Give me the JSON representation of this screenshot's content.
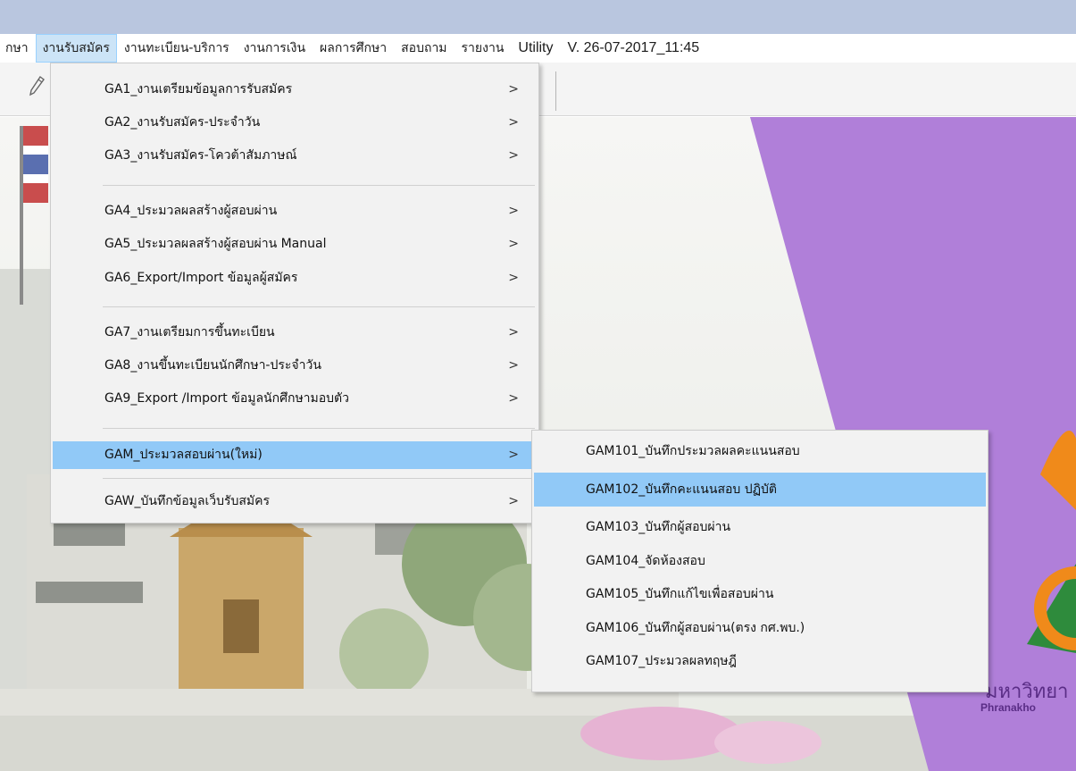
{
  "menubar": {
    "items": [
      {
        "label": "กษา"
      },
      {
        "label": "งานรับสมัคร",
        "active": true
      },
      {
        "label": "งานทะเบียน-บริการ"
      },
      {
        "label": "งานการเงิน"
      },
      {
        "label": "ผลการศึกษา"
      },
      {
        "label": "สอบถาม"
      },
      {
        "label": "รายงาน"
      },
      {
        "label": "Utility"
      }
    ],
    "version": "V. 26-07-2017_11:45"
  },
  "toolbar": {
    "edit_icon": "pencil-icon"
  },
  "dropdown": {
    "items": [
      {
        "label": "GA1_งานเตรียมข้อมูลการรับสมัคร",
        "arrow": ">"
      },
      {
        "label": "GA2_งานรับสมัคร-ประจำวัน",
        "arrow": ">"
      },
      {
        "label": "GA3_งานรับสมัคร-โควต้าสัมภาษณ์",
        "arrow": ">"
      },
      {
        "label": "GA4_ประมวลผลสร้างผู้สอบผ่าน",
        "arrow": ">"
      },
      {
        "label": "GA5_ประมวลผลสร้างผู้สอบผ่าน Manual",
        "arrow": ">"
      },
      {
        "label": "GA6_Export/Import ข้อมูลผู้สมัคร",
        "arrow": ">"
      },
      {
        "label": "GA7_งานเตรียมการขึ้นทะเบียน",
        "arrow": ">"
      },
      {
        "label": "GA8_งานขึ้นทะเบียนนักศึกษา-ประจำวัน",
        "arrow": ">"
      },
      {
        "label": "GA9_Export /Import ข้อมูลนักศึกษามอบตัว",
        "arrow": ">"
      },
      {
        "label": "GAM_ประมวลสอบผ่าน(ใหม่)",
        "arrow": ">",
        "highlighted": true
      },
      {
        "label": "GAW_บันทึกข้อมูลเว็บรับสมัคร",
        "arrow": ">"
      }
    ]
  },
  "submenu": {
    "items": [
      {
        "label": "GAM101_บันทึกประมวลผลคะแนนสอบ"
      },
      {
        "label": "GAM102_บันทึกคะแนนสอบ ปฏิบัติ",
        "highlighted": true
      },
      {
        "label": "GAM103_บันทึกผู้สอบผ่าน"
      },
      {
        "label": "GAM104_จัดห้องสอบ"
      },
      {
        "label": "GAM105_บันทึกแก้ไขเพื่อสอบผ่าน"
      },
      {
        "label": "GAM106_บันทึกผู้สอบผ่าน(ตรง กศ.พบ.)"
      },
      {
        "label": "GAM107_ประมวลผลทฤษฎี"
      }
    ]
  },
  "background": {
    "logo_text": "มหาวิทยา",
    "logo_subtext": "Phranakho",
    "colors": {
      "purple": "#b07fd9",
      "menu_bg": "#f2f2f2",
      "highlight": "#91c9f7",
      "titlebar": "#b9c6df"
    }
  }
}
